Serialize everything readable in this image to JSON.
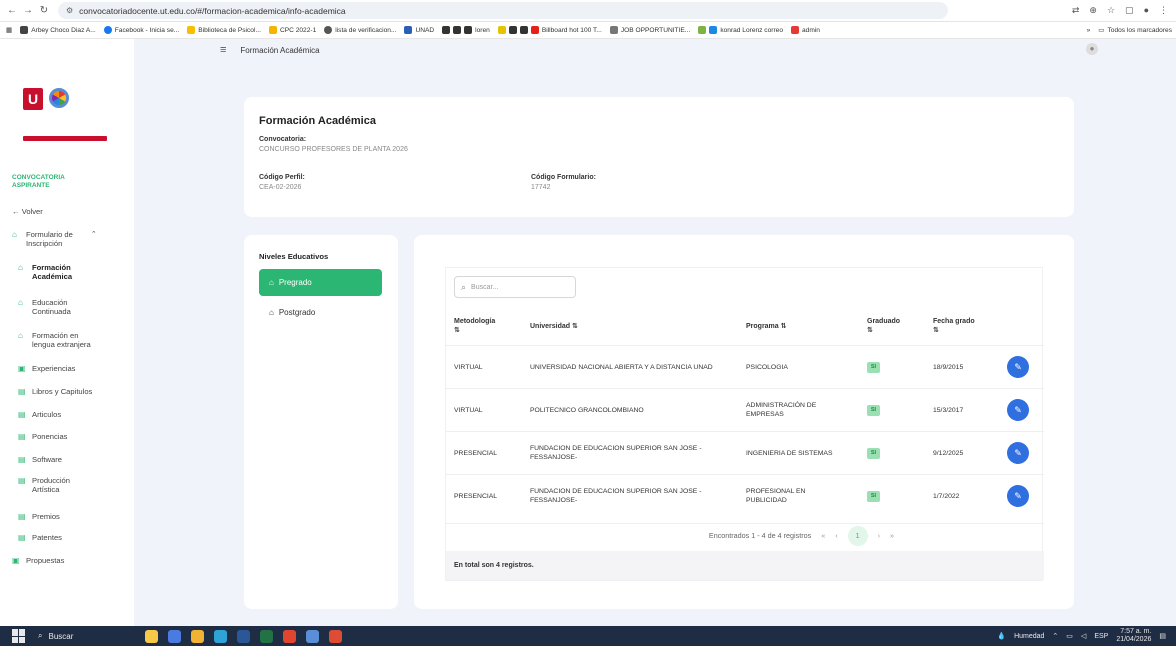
{
  "browser": {
    "url": "convocatoriadocente.ut.edu.co/#/formacion-academica/info-academica"
  },
  "bookmarks": [
    "Arbey Choco Diaz A...",
    "Facebook - Inicia se...",
    "Biblioteca de Psicol...",
    "CPC 2022-1",
    "lista de verificacion...",
    "UNAD",
    "loren",
    "Billboard hot 100 T...",
    "JOB OPPORTUNITIE...",
    "konrad Lorenz correo",
    "admin"
  ],
  "bookmarks_all": "Todos los marcadores",
  "header": {
    "title": "Formación Académica"
  },
  "sidebar": {
    "title_line1": "CONVOCATORIA",
    "title_line2": "ASPIRANTE",
    "back": "← Volver",
    "items": [
      {
        "l1": "Formulario de",
        "l2": "Inscripción",
        "chev": "⌃"
      },
      {
        "l1": "Formación",
        "l2": "Académica"
      },
      {
        "l1": "Educación",
        "l2": "Continuada"
      },
      {
        "l1": "Formación en",
        "l2": "lengua extranjera"
      },
      {
        "l1": "Experiencias"
      },
      {
        "l1": "Libros y Capitulos"
      },
      {
        "l1": "Articulos"
      },
      {
        "l1": "Ponencias"
      },
      {
        "l1": "Software"
      },
      {
        "l1": "Producción",
        "l2": "Artística"
      },
      {
        "l1": "Premios"
      },
      {
        "l1": "Patentes"
      },
      {
        "l1": "Propuestas"
      }
    ]
  },
  "info": {
    "title": "Formación Académica",
    "conv_label": "Convocatoria:",
    "conv_value": "CONCURSO PROFESORES DE PLANTA 2026",
    "perfil_label": "Código Perfil:",
    "perfil_value": "CEA-02-2026",
    "form_label": "Código Formulario:",
    "form_value": "17742"
  },
  "niveles": {
    "title": "Niveles Educativos",
    "items": [
      "Pregrado",
      "Postgrado"
    ]
  },
  "table": {
    "search_placeholder": "Buscar...",
    "headers": {
      "metodologia": "Metodología",
      "universidad": "Universidad",
      "programa": "Programa",
      "graduado": "Graduado",
      "fecha": "Fecha grado",
      "sort": "⇅"
    },
    "rows": [
      {
        "metodologia": "VIRTUAL",
        "universidad": "UNIVERSIDAD NACIONAL ABIERTA Y A DISTANCIA UNAD",
        "programa": "PSICOLOGIA",
        "graduado": "SI",
        "fecha": "18/9/2015"
      },
      {
        "metodologia": "VIRTUAL",
        "universidad": "POLITECNICO GRANCOLOMBIANO",
        "programa": "ADMINISTRACIÓN DE EMPRESAS",
        "graduado": "SI",
        "fecha": "15/3/2017"
      },
      {
        "metodologia": "PRESENCIAL",
        "universidad": "FUNDACION DE EDUCACION SUPERIOR SAN JOSE - FESSANJOSE-",
        "programa": "INGENIERIA DE SISTEMAS",
        "graduado": "SI",
        "fecha": "9/12/2025"
      },
      {
        "metodologia": "PRESENCIAL",
        "universidad": "FUNDACION DE EDUCACION SUPERIOR SAN JOSE - FESSANJOSE-",
        "programa": "PROFESIONAL EN PUBLICIDAD",
        "graduado": "SI",
        "fecha": "1/7/2022"
      }
    ],
    "pager": {
      "text": "Encontrados 1 - 4 de 4 registros",
      "first": "«",
      "prev": "‹",
      "page": "1",
      "next": "›",
      "last": "»"
    },
    "total": "En total son 4 registros."
  },
  "taskbar": {
    "search": "Buscar",
    "weather": "Humedad",
    "lang": "ESP",
    "time": "7:57 a. m.",
    "date": "21/04/2026"
  },
  "colors": {
    "accent": "#2bb673",
    "edit": "#2f6fe0",
    "brand_red": "#c8102e"
  }
}
